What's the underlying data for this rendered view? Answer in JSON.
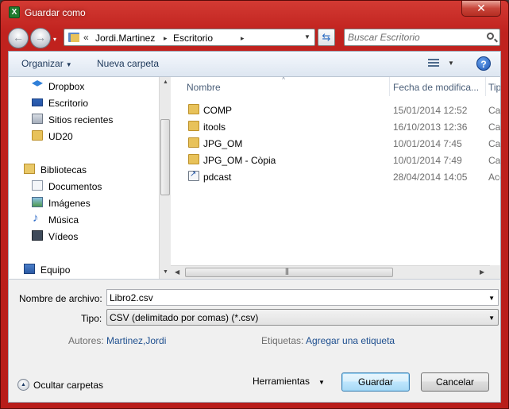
{
  "window": {
    "title": "Guardar como",
    "app_icon_letter": "X",
    "close_glyph": "✕"
  },
  "address": {
    "overflow": "«",
    "parts": [
      "Jordi.Martinez",
      "Escritorio"
    ],
    "separator": "▸",
    "dropdown": "▼",
    "refresh_glyph": "⇆"
  },
  "nav_buttons": {
    "back": "←",
    "forward": "→",
    "history_drop": "▾"
  },
  "search": {
    "placeholder": "Buscar Escritorio",
    "value": ""
  },
  "toolbar": {
    "organize_label": "Organizar",
    "organize_caret": "▼",
    "new_folder_label": "Nueva carpeta",
    "view_caret": "▼",
    "help_glyph": "?"
  },
  "sidebar": {
    "favorites": [
      {
        "label": "Dropbox",
        "icon": "dropbox-icon"
      },
      {
        "label": "Escritorio",
        "icon": "desktop-icon"
      },
      {
        "label": "Sitios recientes",
        "icon": "recent-places-icon"
      },
      {
        "label": "UD20",
        "icon": "folder-icon"
      }
    ],
    "libraries": {
      "label": "Bibliotecas",
      "icon": "libraries-icon"
    },
    "library_items": [
      {
        "label": "Documentos",
        "icon": "documents-icon"
      },
      {
        "label": "Imágenes",
        "icon": "pictures-icon"
      },
      {
        "label": "Música",
        "icon": "music-icon"
      },
      {
        "label": "Vídeos",
        "icon": "videos-icon"
      }
    ],
    "computer": {
      "label": "Equipo",
      "icon": "computer-icon"
    },
    "scroll_up": "▲",
    "scroll_down": "▼"
  },
  "file_list": {
    "columns": [
      "Nombre",
      "Fecha de modifica...",
      "Tipo"
    ],
    "sort_caret": "˄",
    "rows": [
      {
        "name": "COMP",
        "date": "15/01/2014 12:52",
        "type": "Carpeta de archivos",
        "icon": "folder-icon"
      },
      {
        "name": "itools",
        "date": "16/10/2013 12:36",
        "type": "Carpeta de archivos",
        "icon": "folder-icon"
      },
      {
        "name": "JPG_OM",
        "date": "10/01/2014 7:45",
        "type": "Carpeta de archivos",
        "icon": "folder-icon"
      },
      {
        "name": "JPG_OM - Còpia",
        "date": "10/01/2014 7:49",
        "type": "Carpeta de archivos",
        "icon": "folder-icon"
      },
      {
        "name": "pdcast",
        "date": "28/04/2014 14:05",
        "type": "Acceso directo",
        "icon": "shortcut-icon"
      }
    ],
    "hscroll_left": "◀",
    "hscroll_right": "▶",
    "hscroll_grip": "|||"
  },
  "form": {
    "filename_label": "Nombre de archivo:",
    "filename_value": "Libro2.csv",
    "type_label": "Tipo:",
    "type_value": "CSV (delimitado por comas) (*.csv)",
    "dropdown": "▼",
    "authors_label": "Autores:",
    "authors_value": "Martinez,Jordi",
    "tags_label": "Etiquetas:",
    "tags_value": "Agregar una etiqueta"
  },
  "footer": {
    "hide_folders_label": "Ocultar carpetas",
    "hide_folders_glyph": "▲",
    "tools_label": "Herramientas",
    "tools_caret": "▼",
    "save_label": "Guardar",
    "cancel_label": "Cancelar"
  }
}
